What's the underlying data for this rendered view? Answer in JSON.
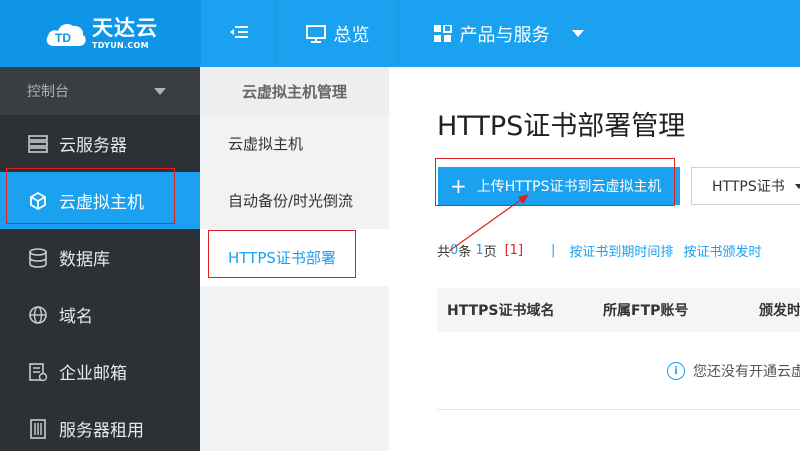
{
  "logo": {
    "cn": "天达云",
    "en": "TDYUN.COM"
  },
  "topnav": {
    "menu_icon": "menu-fold-icon",
    "overview": "总览",
    "products": "产品与服务",
    "accent": "#1aa1f0"
  },
  "sidebar": {
    "console": "控制台",
    "items": [
      {
        "label": "云服务器",
        "icon": "server-icon"
      },
      {
        "label": "云虚拟主机",
        "icon": "cube-icon",
        "active": true
      },
      {
        "label": "数据库",
        "icon": "database-icon"
      },
      {
        "label": "域名",
        "icon": "globe-icon"
      },
      {
        "label": "企业邮箱",
        "icon": "mail-icon"
      },
      {
        "label": "服务器租用",
        "icon": "rack-icon"
      }
    ]
  },
  "submenu": {
    "header": "云虚拟主机管理",
    "items": [
      {
        "label": "云虚拟主机"
      },
      {
        "label": "自动备份/时光倒流"
      },
      {
        "label": "HTTPS证书部署",
        "active": true
      }
    ]
  },
  "main": {
    "title": "HTTPS证书部署管理",
    "upload_button": "上传HTTPS证书到云虚拟主机",
    "cert_select": "HTTPS证书",
    "pager": {
      "prefix": "共",
      "count": "0",
      "mid": "条",
      "pages": "1",
      "suffix": "页",
      "current": "[1]",
      "separator": "|",
      "sort_expiry": "按证书到期时间排",
      "sort_issue": "按证书颁发时"
    },
    "table": {
      "headers": [
        "HTTPS证书域名",
        "所属FTP账号",
        "颁发时"
      ],
      "empty_text": "您还没有开通云虚"
    }
  }
}
